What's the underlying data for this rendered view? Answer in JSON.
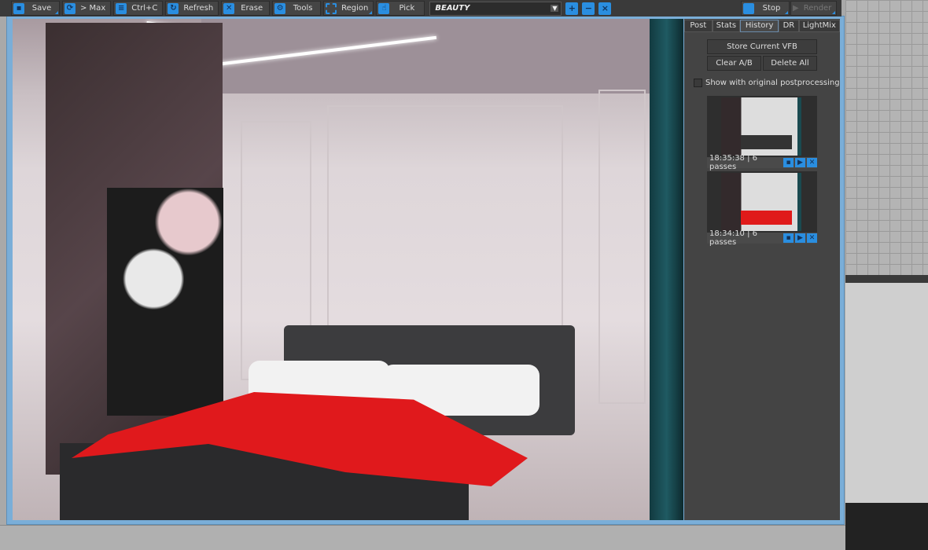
{
  "toolbar": {
    "save": "Save",
    "max": "> Max",
    "copy": "Ctrl+C",
    "refresh": "Refresh",
    "erase": "Erase",
    "tools": "Tools",
    "region": "Region",
    "pick": "Pick",
    "channel": "BEAUTY",
    "stop": "Stop",
    "render": "Render"
  },
  "side": {
    "tabs": [
      "Post",
      "Stats",
      "History",
      "DR",
      "LightMix"
    ],
    "active_tab": "History",
    "store": "Store Current VFB",
    "clear": "Clear A/B",
    "delete_all": "Delete All",
    "show_original": "Show with original postprocessing",
    "history": [
      {
        "label": "18:35:38 | 6 passes"
      },
      {
        "label": "18:34:10 | 6 passes"
      }
    ]
  },
  "colors": {
    "accent": "#2a8ee0",
    "blanket": "#e0191c"
  }
}
